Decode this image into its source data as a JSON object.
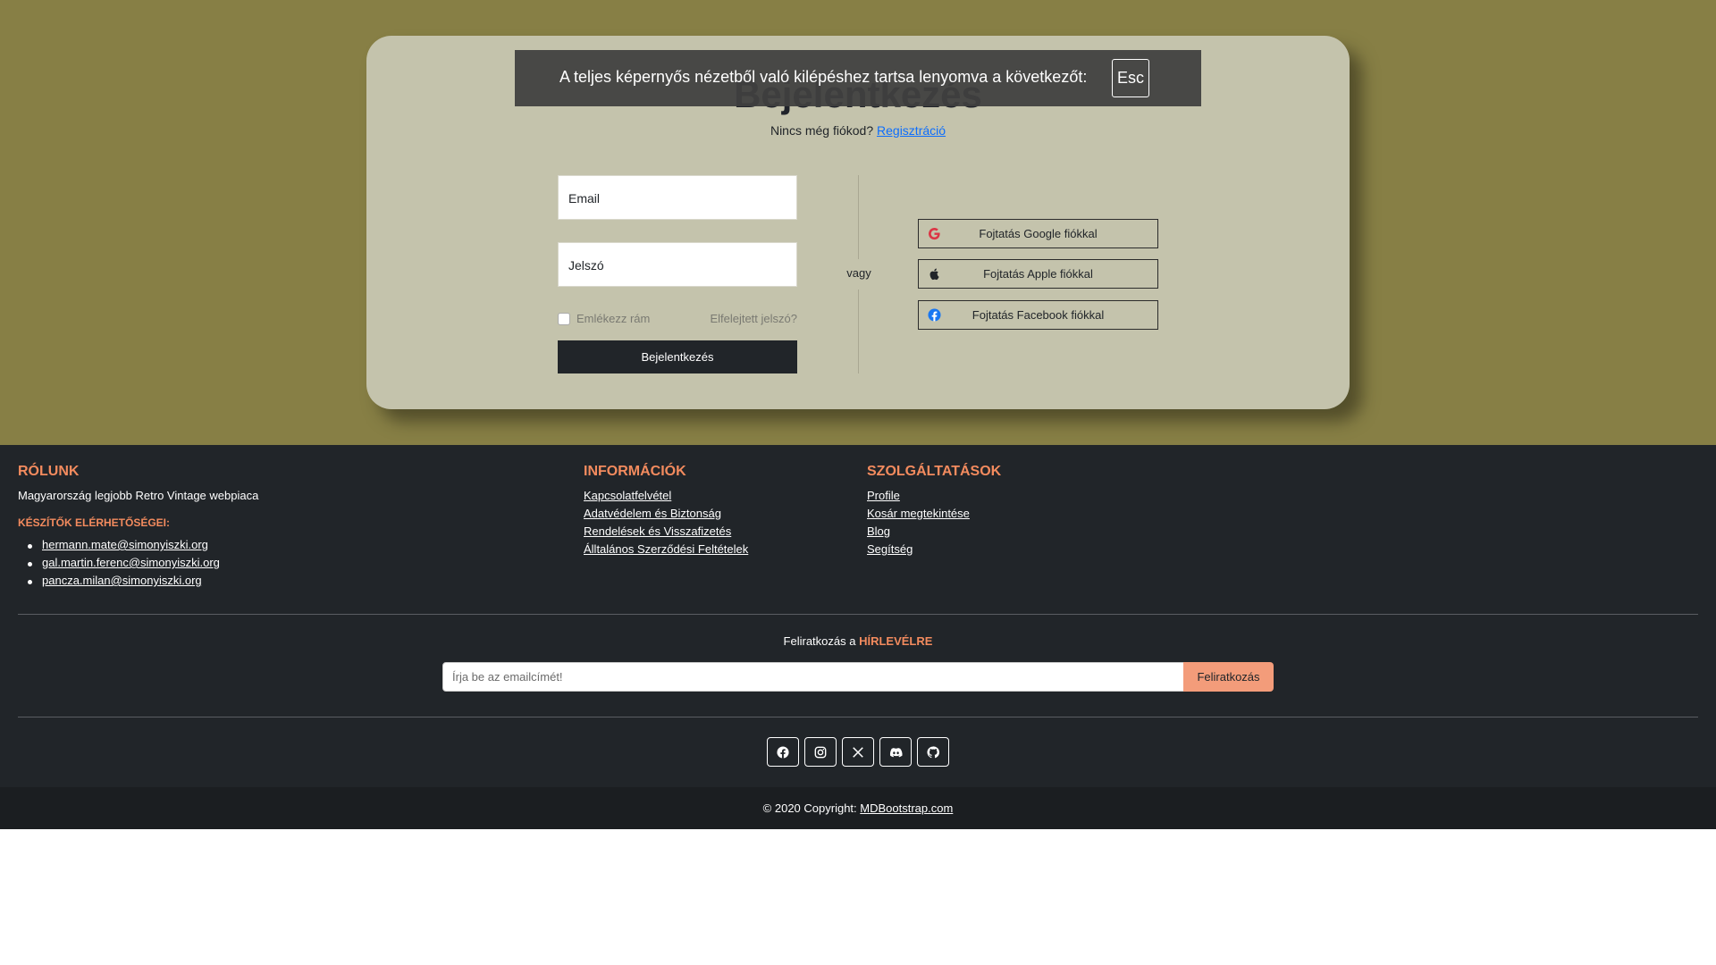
{
  "login": {
    "title": "Bejelentkezés",
    "no_account": "Nincs még fiókod?",
    "register_link": "Regisztráció",
    "email_placeholder": "Email",
    "password_placeholder": "Jelszó",
    "remember": "Emlékezz rám",
    "forgot": "Elfelejtett jelszó?",
    "submit": "Bejelentkezés",
    "or": "vagy",
    "google": "Fojtatás Google fiókkal",
    "apple": "Fojtatás Apple fiókkal",
    "facebook": "Fojtatás Facebook fiókkal"
  },
  "fullscreen_notice": {
    "text": "A teljes képernyős nézetből való kilépéshez tartsa lenyomva a következőt:",
    "key": "Esc"
  },
  "footer": {
    "about_title": "RÓLUNK",
    "about_text": "Magyarország legjobb Retro Vintage webpiaca",
    "contacts_title": "KÉSZÍTŐK ELÉRHETŐSÉGEI:",
    "contacts": [
      "hermann.mate@simonyiszki.org",
      "gal.martin.ferenc@simonyiszki.org",
      "pancza.milan@simonyiszki.org"
    ],
    "info_title": "INFORMÁCIÓK",
    "info_links": [
      "Kapcsolatfelvétel",
      "Adatvédelem és Biztonság",
      "Rendelések és Visszafizetés",
      "Álltalános Szerződési Feltételek"
    ],
    "services_title": "SZOLGÁLTATÁSOK",
    "services_links": [
      "Profile",
      "Kosár megtekintése",
      "Blog",
      "Segítség"
    ],
    "newsletter_prefix": "Feliratkozás a",
    "newsletter_highlight": "HÍRLEVÉLRE",
    "newsletter_placeholder": "Írja be az emailcímét!",
    "newsletter_button": "Feliratkozás",
    "social_icons": [
      "facebook-icon",
      "instagram-icon",
      "x-icon",
      "discord-icon",
      "github-icon"
    ],
    "copyright": "© 2020 Copyright:",
    "copyright_link": "MDBootstrap.com"
  },
  "colors": {
    "hero_bg": "#877f45",
    "card_bg": "#c4c3ac",
    "footer_bg": "#212529",
    "accent": "#f38b5e",
    "subscribe_button": "#f39c7a"
  }
}
